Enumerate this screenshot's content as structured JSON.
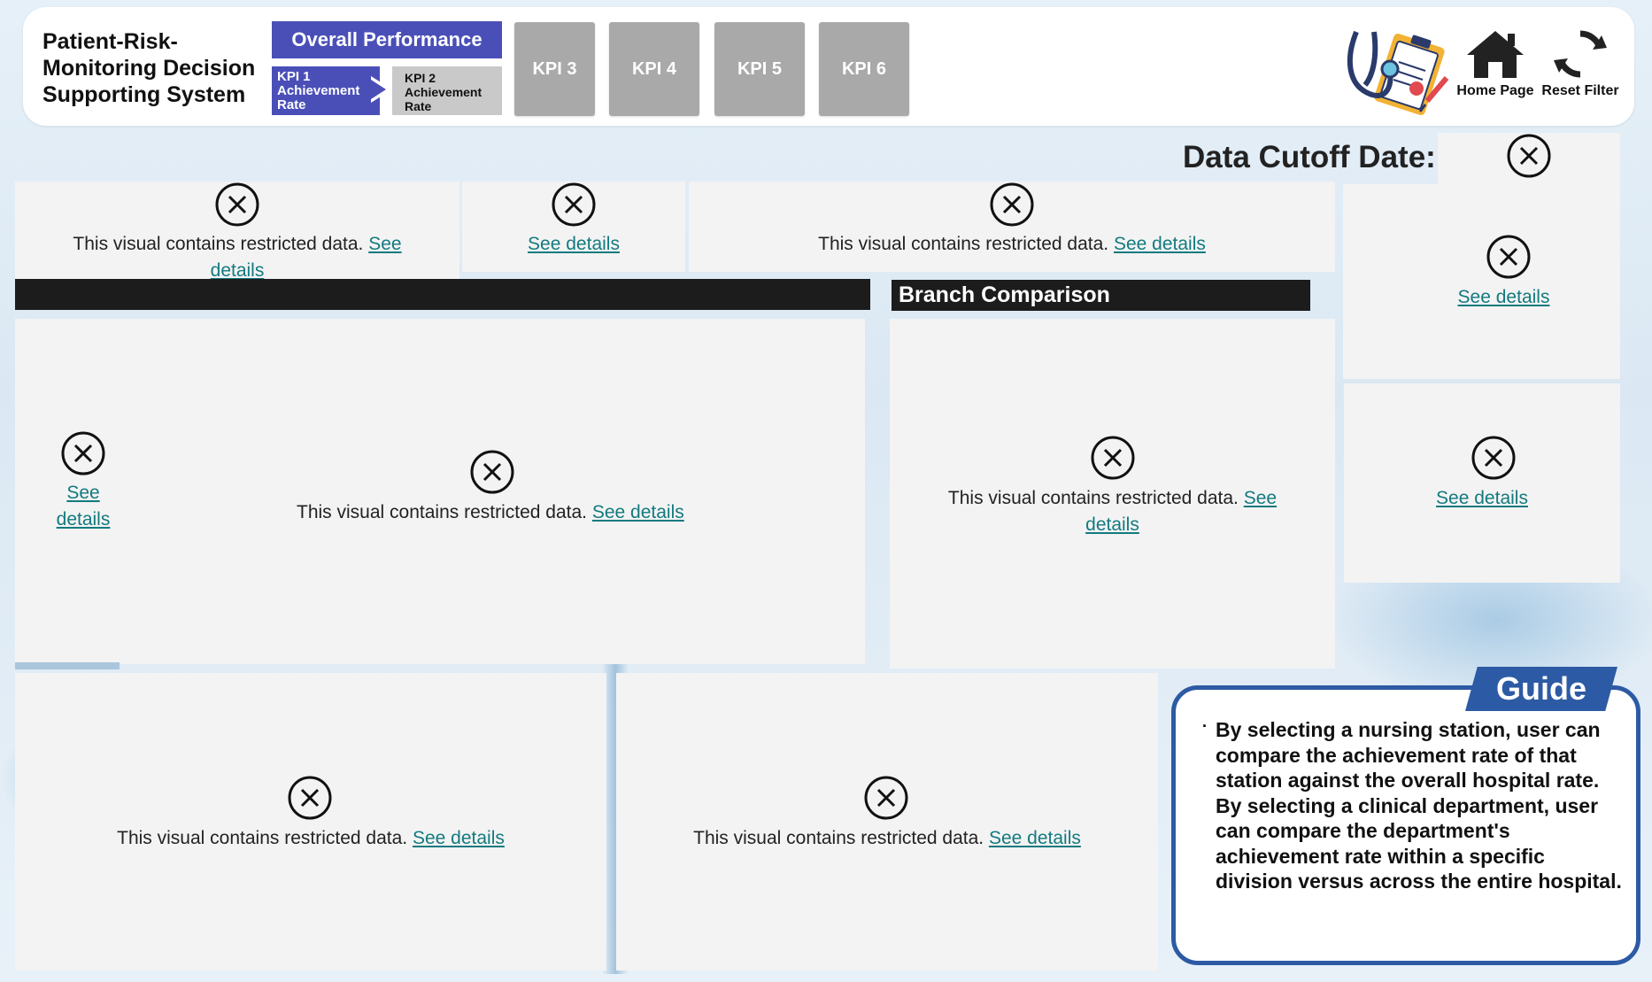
{
  "header": {
    "title": "Patient-Risk-Monitoring Decision Supporting System",
    "overall_performance": "Overall Performance",
    "kpi1_label": "KPI 1 Achievement Rate",
    "kpi2_label": "KPI 2 Achievement Rate",
    "kpi3": "KPI 3",
    "kpi4": "KPI 4",
    "kpi5": "KPI 5",
    "kpi6": "KPI 6",
    "home_label": "Home Page",
    "reset_label": "Reset Filter",
    "icons": [
      "stethoscope-clipboard-icon",
      "home-icon",
      "reset-icon"
    ]
  },
  "cutoff": {
    "label": "Data Cutoff Date:"
  },
  "restricted": {
    "message": "This visual contains restricted data.",
    "link": "See details",
    "link_short_1": "See",
    "link_short_2": "details"
  },
  "sections": {
    "branch_comparison": "Branch Comparison"
  },
  "guide": {
    "title": "Guide",
    "bullet": "·",
    "text": "By selecting a nursing station, user can compare the achievement rate of that station against the overall hospital rate. By selecting a clinical department, user can compare the department's achievement rate within a specific division versus across the entire hospital."
  },
  "colors": {
    "primary_button": "#4a4fb8",
    "kpi_tile": "#a9a9a9",
    "link": "#137a7f",
    "guide_border": "#2d5aa4"
  }
}
